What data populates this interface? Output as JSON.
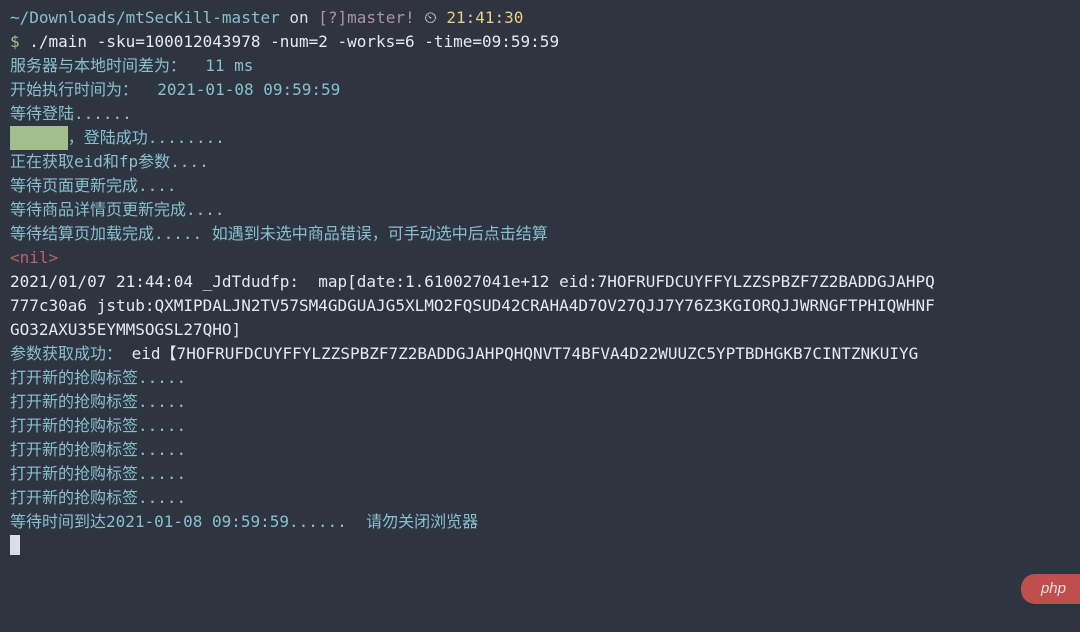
{
  "prompt": {
    "path": "~/Downloads/mtSecKill-master",
    "on": " on ",
    "branch_prefix": "[?]",
    "branch": "master",
    "branch_suffix": "!",
    "clock_icon": " ⏲ ",
    "time": "21:41:30",
    "symbol": "$ ",
    "command": "./main -sku=100012043978 -num=2 -works=6 -time=09:59:59"
  },
  "output": {
    "l1": "服务器与本地时间差为：  11 ms",
    "l2": "开始执行时间为：  2021-01-08 09:59:59",
    "l3": "等待登陆......",
    "l4_redacted": "██████",
    "l4_rest": "，登陆成功........",
    "l5": "正在获取eid和fp参数....",
    "l6": "等待页面更新完成....",
    "l7": "等待商品详情页更新完成....",
    "l8": "等待结算页加载完成..... 如遇到未选中商品错误，可手动选中后点击结算",
    "l9": "<nil>",
    "l10": "2021/01/07 21:44:04 _JdTdudfp:  map[date:1.610027041e+12 eid:7HOFRUFDCUYFFYLZZSPBZF7Z2BADDGJAHPQ",
    "l11": "777c30a6 jstub:QXMIPDALJN2TV57SM4GDGUAJG5XLMO2FQSUD42CRAHA4D7OV27QJJ7Y76Z3KGIORQJJWRNGFTPHIQWHNF",
    "l12": "GO32AXU35EYMMSOGSL27QHO]",
    "l13_a": "参数获取成功：",
    "l13_b": "eid【7HOFRUFDCUYFFYLZZSPBZF7Z2BADDGJAHPQHQNVT74BFVA4D22WUUZC5YPTBDHGKB7CINTZNKUIYG",
    "l14": "打开新的抢购标签.....",
    "l15": "打开新的抢购标签.....",
    "l16": "打开新的抢购标签.....",
    "l17": "打开新的抢购标签.....",
    "l18": "打开新的抢购标签.....",
    "l19": "打开新的抢购标签.....",
    "l20": "等待时间到达2021-01-08 09:59:59......  请勿关闭浏览器"
  },
  "watermark": "php"
}
